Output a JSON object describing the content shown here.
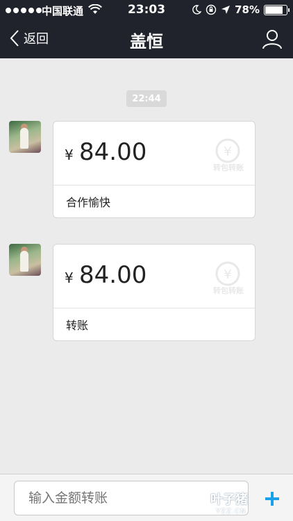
{
  "status_bar": {
    "carrier": "中国联通",
    "time": "23:03",
    "battery": "78%"
  },
  "nav": {
    "back_label": "返回",
    "title": "盖恒"
  },
  "chat": {
    "timestamp": "22:44",
    "messages": [
      {
        "currency": "¥",
        "amount": "84.00",
        "memo": "合作愉快",
        "wallet_label": "转包转账"
      },
      {
        "currency": "¥",
        "amount": "84.00",
        "memo": "转账",
        "wallet_label": "转包转账"
      }
    ]
  },
  "input": {
    "placeholder": "输入金额转账"
  },
  "watermark": {
    "text": "叶子猪",
    "url": "YZZ.CN"
  },
  "colors": {
    "header_bg": "#20232b",
    "chat_bg": "#ebebeb",
    "accent": "#1aa0e8"
  }
}
